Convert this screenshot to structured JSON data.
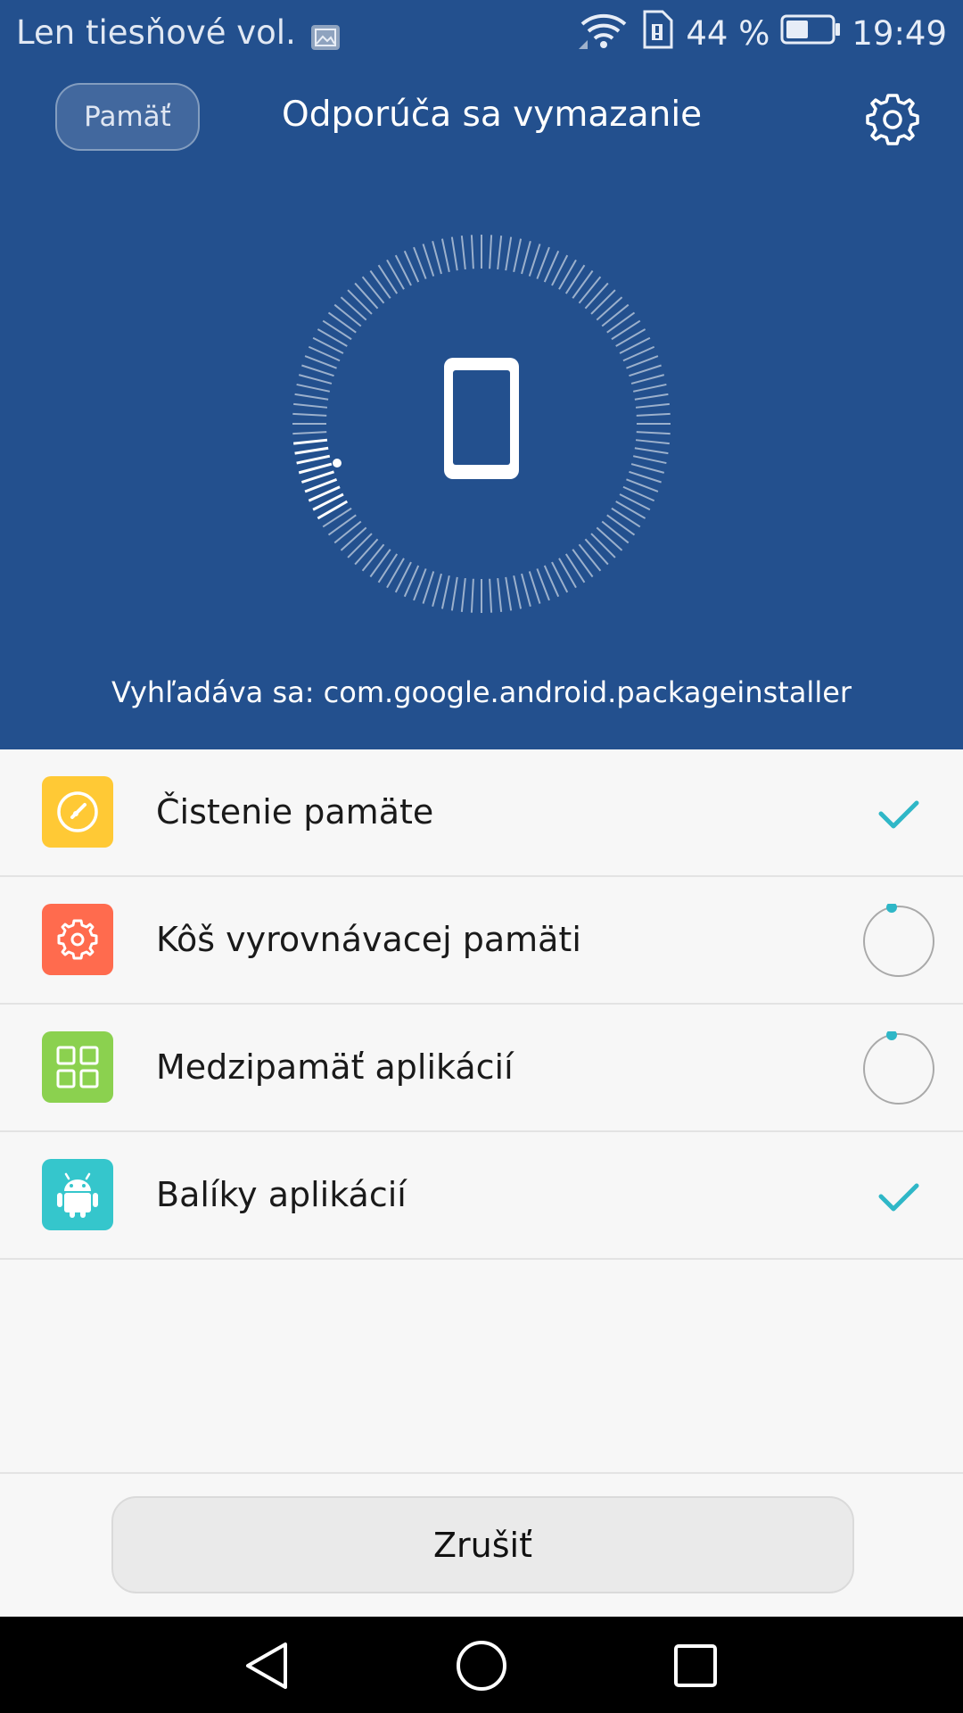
{
  "status_bar": {
    "carrier": "Len tiesňové vol.",
    "battery_percent": "44 %",
    "time": "19:49"
  },
  "header": {
    "tab_label": "Pamäť",
    "title": "Odporúča sa vymazanie"
  },
  "scan": {
    "text": "Vyhľadáva sa: com.google.android.packageinstaller"
  },
  "items": [
    {
      "label": "Čistenie pamäte",
      "icon": "memory-cleanup-icon",
      "color": "#ffc935",
      "status": "done"
    },
    {
      "label": "Kôš vyrovnávacej pamäti",
      "icon": "cache-bin-icon",
      "color": "#ff6b4e",
      "status": "loading"
    },
    {
      "label": "Medzipamäť aplikácií",
      "icon": "app-cache-icon",
      "color": "#8bd14f",
      "status": "loading"
    },
    {
      "label": "Balíky aplikácií",
      "icon": "android-icon",
      "color": "#35c6cc",
      "status": "done"
    }
  ],
  "footer": {
    "cancel_label": "Zrušiť"
  },
  "colors": {
    "header_bg": "#23508e",
    "accent": "#2fb7c7"
  }
}
